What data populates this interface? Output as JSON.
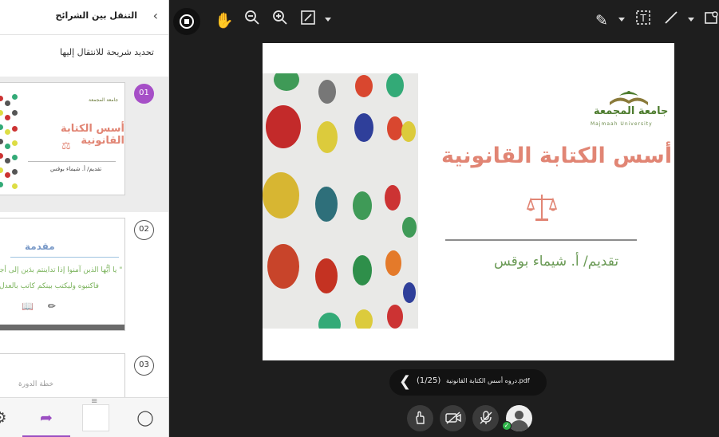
{
  "panel": {
    "title": "التنقل بين الشرائح",
    "subtitle": "تحديد شريحة للانتقال إليها",
    "slides": [
      {
        "number": "01",
        "title": "أسس الكتابة القانونية",
        "presenter": "تقديم/ أ. شيماء بوقس",
        "logo_text": "جامعة المجمعة",
        "selected": true
      },
      {
        "number": "02",
        "heading": "مقدمة",
        "quote_line1": "\" يا أيُّها الذين آمنوا إذا تداينتم بدَين إلى أجل",
        "quote_line2": "فاكتبوه وليكتب بينكم كاتب بالعدل\"",
        "selected": false
      },
      {
        "number": "03",
        "heading": "خطة الدورة",
        "selected": false
      }
    ]
  },
  "bottom_nav": [
    "gear-icon",
    "share-screen-icon",
    "blank-tab",
    "chat-icon"
  ],
  "toolbar": {
    "left": [
      "stop-share-icon",
      "hand-pan-icon",
      "zoom-out-icon",
      "zoom-in-icon",
      "fit-screen-icon"
    ],
    "right": [
      "pen-icon",
      "text-tool-icon",
      "line-tool-icon",
      "shape-tool-icon"
    ]
  },
  "slide": {
    "university_ar": "جامعة المجمعة",
    "university_en": "Majmaah University",
    "title": "أسس الكتابة القانونية",
    "presenter": "تقديم/ أ. شيماء بوقس"
  },
  "pager": {
    "file_name": "دروه أسس الكتابة القانونية.pdf",
    "page_label": "(1/25)"
  },
  "controls": [
    "hand-raise-icon",
    "camera-off-icon",
    "mic-off-icon",
    "avatar"
  ],
  "colors": {
    "accent": "#a64fc7",
    "title": "#e18574",
    "green": "#4d7c2e",
    "status_ok": "#2fb64a"
  }
}
